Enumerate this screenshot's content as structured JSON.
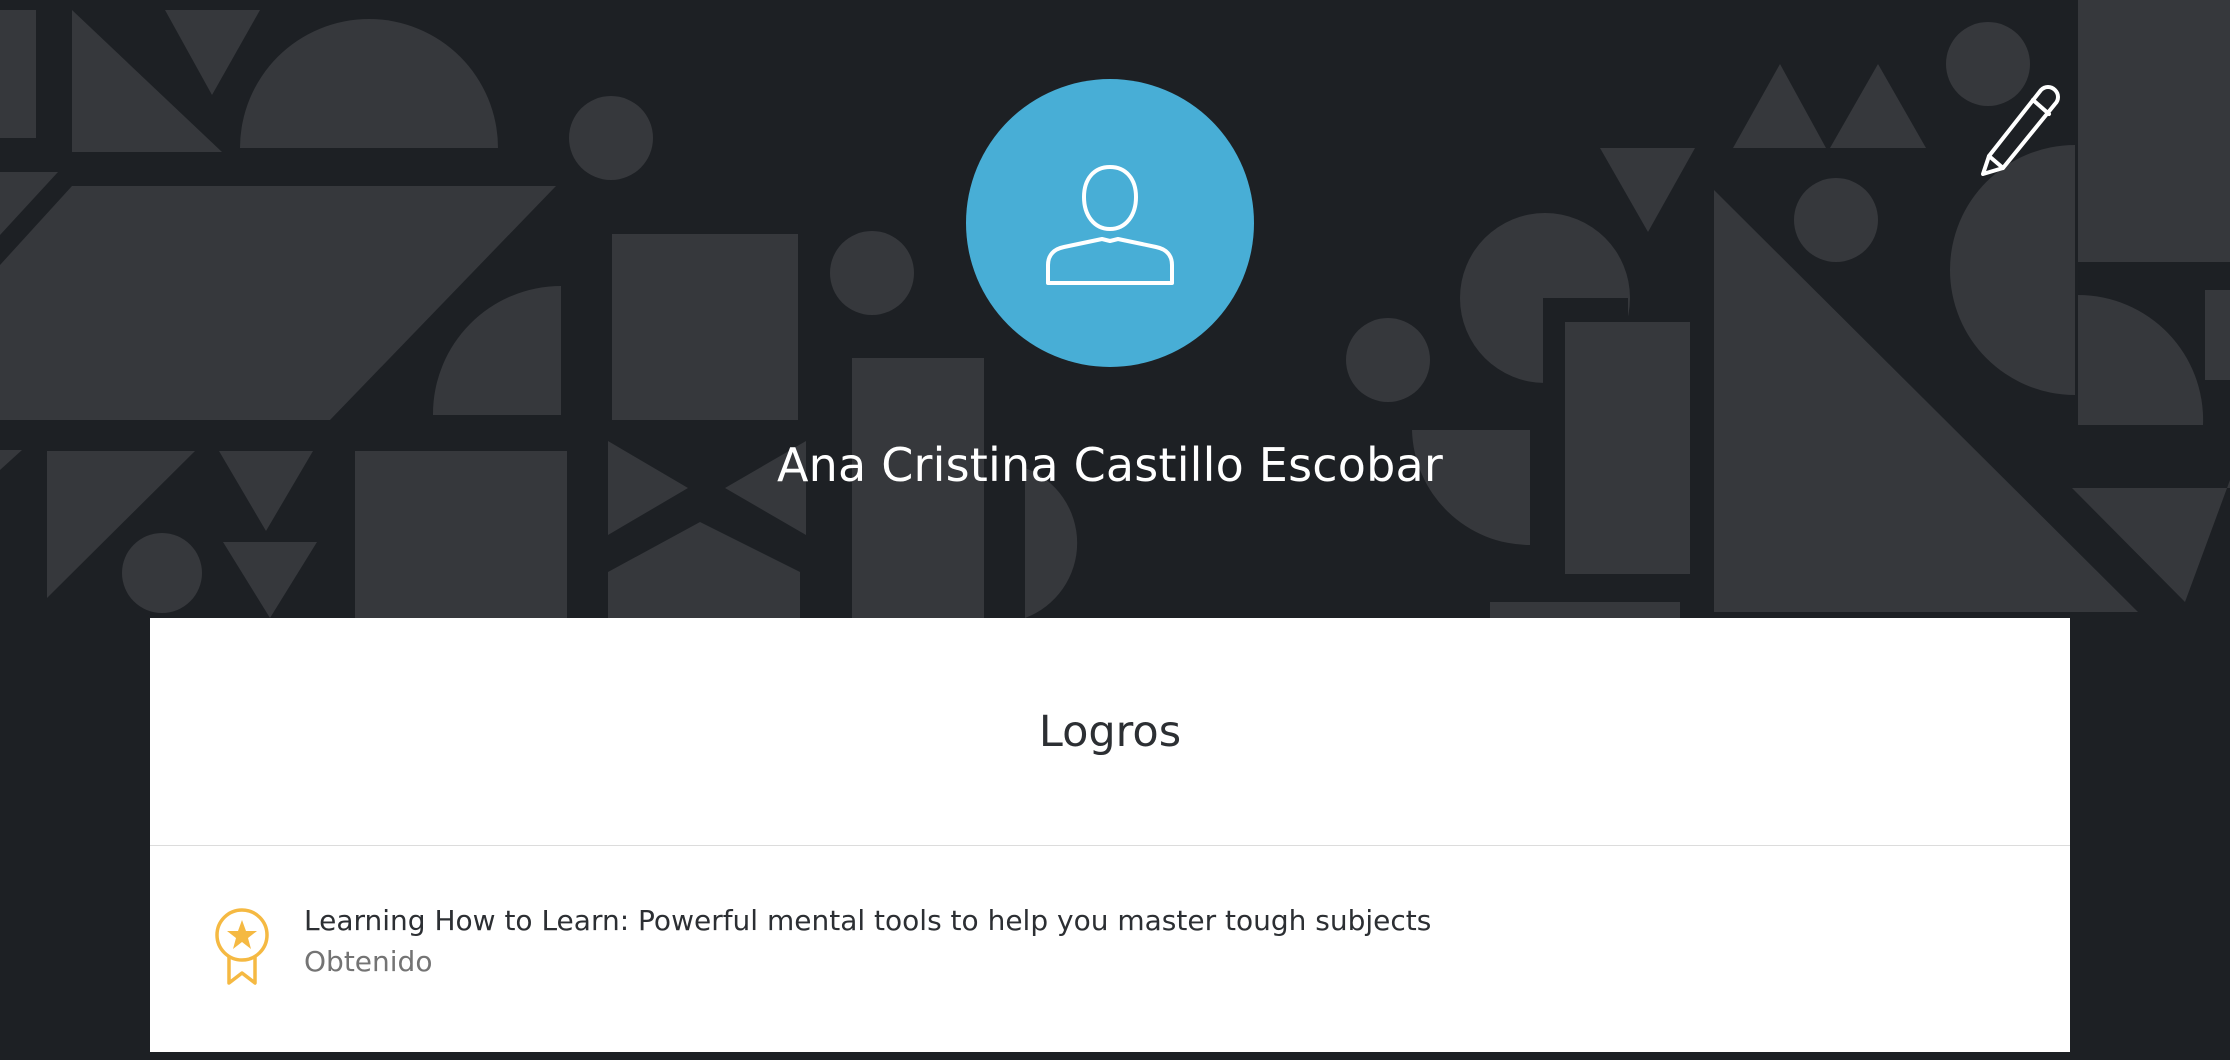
{
  "profile": {
    "name": "Ana Cristina Castillo Escobar",
    "avatar_icon": "user-silhouette-icon",
    "avatar_color": "#48aed6",
    "edit_icon": "pencil-icon"
  },
  "achievements": {
    "title": "Logros",
    "items": [
      {
        "title": "Learning How to Learn: Powerful mental tools to help you master tough subjects",
        "status": "Obtenido",
        "icon": "award-badge-icon",
        "icon_color": "#f5b942"
      }
    ]
  },
  "colors": {
    "background": "#1d2024",
    "pattern_shape": "#36383c",
    "card": "#ffffff"
  }
}
